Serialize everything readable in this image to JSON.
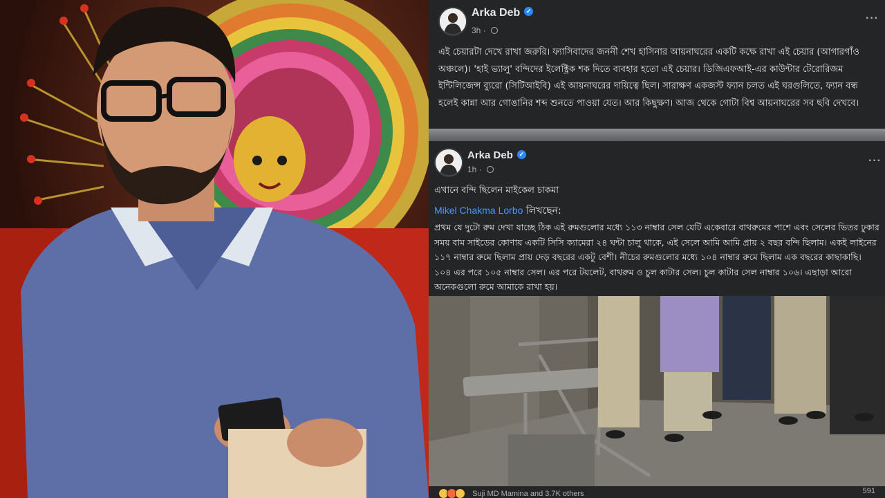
{
  "post1": {
    "author": "Arka Deb",
    "time": "3h",
    "more_label": "···",
    "text": "এই চেয়ারটা দেখে রাখা জরুরি। ফ্যাসিবাদের জননী শেখ হাসিনার আয়নাঘরের একটি কক্ষে রাখা এই চেয়ার (আগারগাঁও অঞ্চলে)। 'হাই ভ্যালু' বন্দিদের ইলেক্ট্রিক শক দিতে ব্যবহার হতো এই চেয়ার। ডিজিএফআই-এর কাউন্টার টেরোরিজম ইন্টিলিজেন্স ব্যুরো (সিটিআইবি) এই আয়নাঘরের দায়িত্বে ছিল। সারাক্ষণ একজস্ট ফ্যান চলত এই ঘরগুলিতে, ফ্যান বন্ধ হলেই কান্না আর গোঙানির শব্দ শুনতে পাওয়া যেত। আর কিছুক্ষণ। আজ থেকে গোটা বিশ্ব আয়নাঘরের সব ছবি দেখবে।"
  },
  "post2": {
    "author": "Arka Deb",
    "time": "1h",
    "more_label": "···",
    "intro": "এখানে বন্দি ছিলেন মাইকেল চাকমা",
    "mention_name": "Mikel Chakma Lorbo",
    "mention_suffix": "লিখছেন:",
    "text": "প্রথম যে দুটো রুম দেখা যাচ্ছে ঠিক এই রুমগুলোর মধ্যে ১১৩ নাম্বার সেল যেটি একেবারে বাথরুমের পাশে এবং সেলের ভিতর ঢুকার সময় বাম সাইডের কোণায় একটি সিসি ক্যামেরা ২৪ ঘন্টা চালু থাকে, এই সেলে আমি আমি প্রায় ২ বছর বন্দি ছিলাম। একই লাইনের ১১৭ নাম্বার রুমে ছিলাম প্রায় দেড় বছরের একটু বেশী। নীচের রুমগুলোর মধ্যে ১০৪ নাম্বার রুমে ছিলাম এক বছরের কাছাকাছি। ১০৪ এর পরে ১০৫ নাম্বার সেল। এর পরে টয়লেট, বাথরুম ও চুল কাটার সেল। চুল কাটার সেল নাম্বার ১০৬। এছাড়া আরো অনেকগুলো রুমে আমাকে রাখা হয়।",
    "reactions_text": "Suji MD Mamina and 3.7K others",
    "reactions_count": "591"
  },
  "colors": {
    "fb_dark": "#242526",
    "link_blue": "#4599ff",
    "verified_blue": "#2d88ff",
    "sweater": "#5e6fa8"
  },
  "icons": [
    "verified-badge-icon",
    "globe-icon",
    "more-options-icon",
    "reaction-emoji-icon"
  ]
}
